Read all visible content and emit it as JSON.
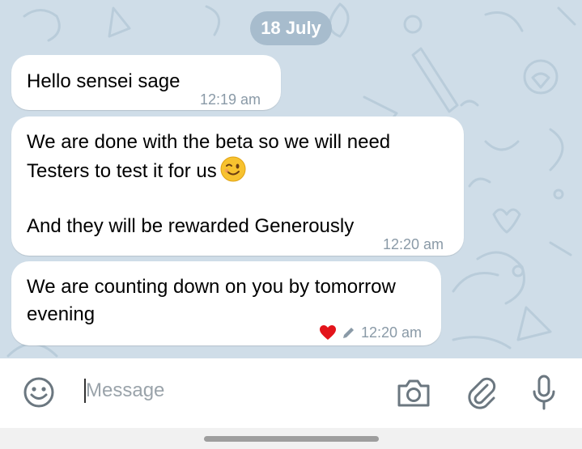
{
  "chat": {
    "date_chip": "18 July",
    "messages": [
      {
        "lines": [
          "Hello sensei sage"
        ],
        "time": "12:19 am"
      },
      {
        "lines": [
          "We are done with the beta so we will need",
          "Testers to test it for us",
          "",
          "And they will be rewarded Generously"
        ],
        "emoji": "winking-face-icon",
        "time": "12:20 am"
      },
      {
        "lines": [
          "We are counting down on you by tomorrow",
          "evening"
        ],
        "reaction": "red-heart-icon",
        "edited": true,
        "time": "12:20 am"
      }
    ]
  },
  "input": {
    "placeholder": "Message"
  },
  "colors": {
    "chat_bg": "#cfdde8",
    "bubble": "#ffffff",
    "date_chip": "#a7bccd",
    "icon_gray": "#6b7780",
    "heart": "#e3141b"
  }
}
